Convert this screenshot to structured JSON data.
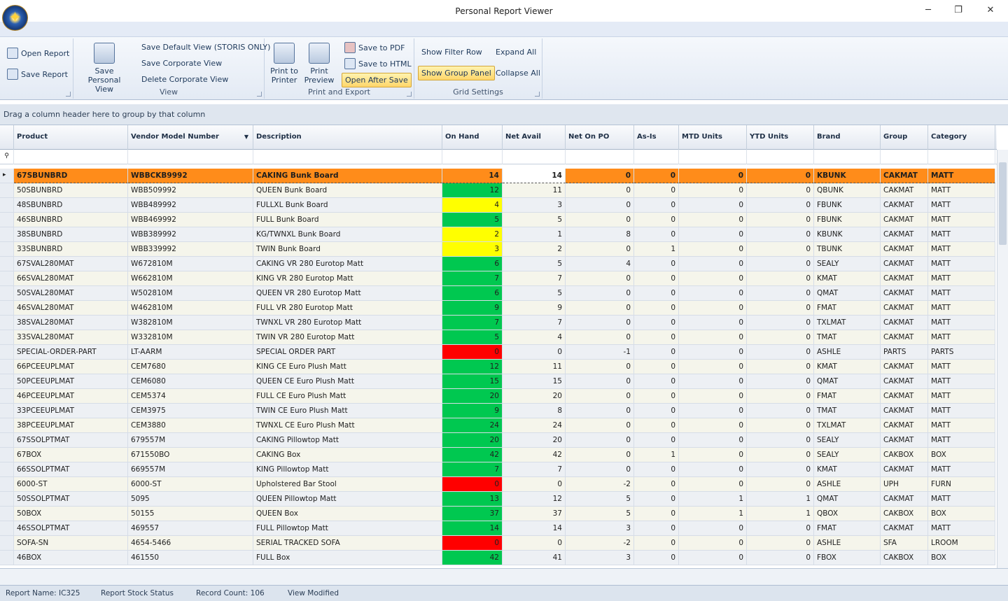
{
  "title": "Personal Report Viewer",
  "window": {
    "minimize": "─",
    "maximize": "❐",
    "close": "✕"
  },
  "ribbon": {
    "open_report": "Open Report",
    "save_report": "Save Report",
    "save_personal_view": "Save Personal View",
    "save_default_view": "Save Default View (STORIS ONLY)",
    "save_corporate_view": "Save Corporate View",
    "delete_corporate_view": "Delete Corporate View",
    "view_group": "View",
    "print_to_printer": "Print to Printer",
    "print_preview": "Print Preview",
    "save_to_pdf": "Save to PDF",
    "save_to_html": "Save to HTML",
    "open_after_save": "Open After Save",
    "print_export_group": "Print and Export",
    "show_filter_row": "Show Filter Row",
    "show_group_panel": "Show Group Panel",
    "expand_all": "Expand All",
    "collapse_all": "Collapse All",
    "grid_settings_group": "Grid Settings"
  },
  "group_panel_text": "Drag a column header here to group by that column",
  "columns": [
    "Product",
    "Vendor Model Number",
    "Description",
    "On Hand",
    "Net Avail",
    "Net On PO",
    "As-Is",
    "MTD Units",
    "YTD Units",
    "Brand",
    "Group",
    "Category"
  ],
  "colors": {
    "green": "#00c850",
    "yellow": "#ffff00",
    "red": "#ff0000",
    "selected": "#ff8c1a"
  },
  "rows": [
    [
      "67SBUNBRD",
      "WBBCKB9992",
      "CAKING Bunk Board",
      "14",
      "14",
      "0",
      "0",
      "0",
      "0",
      "KBUNK",
      "CAKMAT",
      "MATT",
      "sel"
    ],
    [
      "50SBUNBRD",
      "WBB509992",
      "QUEEN Bunk Board",
      "12",
      "11",
      "0",
      "0",
      "0",
      "0",
      "QBUNK",
      "CAKMAT",
      "MATT",
      "green"
    ],
    [
      "48SBUNBRD",
      "WBB489992",
      "FULLXL Bunk Board",
      "4",
      "3",
      "0",
      "0",
      "0",
      "0",
      "FBUNK",
      "CAKMAT",
      "MATT",
      "yellow"
    ],
    [
      "46SBUNBRD",
      "WBB469992",
      "FULL Bunk Board",
      "5",
      "5",
      "0",
      "0",
      "0",
      "0",
      "FBUNK",
      "CAKMAT",
      "MATT",
      "green"
    ],
    [
      "38SBUNBRD",
      "WBB389992",
      "KG/TWNXL Bunk Board",
      "2",
      "1",
      "8",
      "0",
      "0",
      "0",
      "KBUNK",
      "CAKMAT",
      "MATT",
      "yellow"
    ],
    [
      "33SBUNBRD",
      "WBB339992",
      "TWIN Bunk Board",
      "3",
      "2",
      "0",
      "1",
      "0",
      "0",
      "TBUNK",
      "CAKMAT",
      "MATT",
      "yellow"
    ],
    [
      "67SVAL280MAT",
      "W672810M",
      "CAKING VR 280 Eurotop Matt",
      "6",
      "5",
      "4",
      "0",
      "0",
      "0",
      "SEALY",
      "CAKMAT",
      "MATT",
      "green"
    ],
    [
      "66SVAL280MAT",
      "W662810M",
      "KING VR 280 Eurotop Matt",
      "7",
      "7",
      "0",
      "0",
      "0",
      "0",
      "KMAT",
      "CAKMAT",
      "MATT",
      "green"
    ],
    [
      "50SVAL280MAT",
      "W502810M",
      "QUEEN VR 280 Eurotop Matt",
      "6",
      "5",
      "0",
      "0",
      "0",
      "0",
      "QMAT",
      "CAKMAT",
      "MATT",
      "green"
    ],
    [
      "46SVAL280MAT",
      "W462810M",
      "FULL VR 280 Eurotop Matt",
      "9",
      "9",
      "0",
      "0",
      "0",
      "0",
      "FMAT",
      "CAKMAT",
      "MATT",
      "green"
    ],
    [
      "38SVAL280MAT",
      "W382810M",
      "TWNXL VR 280 Eurotop Matt",
      "7",
      "7",
      "0",
      "0",
      "0",
      "0",
      "TXLMAT",
      "CAKMAT",
      "MATT",
      "green"
    ],
    [
      "33SVAL280MAT",
      "W332810M",
      "TWIN VR 280 Eurotop Matt",
      "5",
      "4",
      "0",
      "0",
      "0",
      "0",
      "TMAT",
      "CAKMAT",
      "MATT",
      "green"
    ],
    [
      "SPECIAL-ORDER-PART",
      "LT-AARM",
      "SPECIAL ORDER PART",
      "0",
      "0",
      "-1",
      "0",
      "0",
      "0",
      "ASHLE",
      "PARTS",
      "PARTS",
      "red"
    ],
    [
      "66PCEEUPLMAT",
      "CEM7680",
      "KING CE Euro Plush Matt",
      "12",
      "11",
      "0",
      "0",
      "0",
      "0",
      "KMAT",
      "CAKMAT",
      "MATT",
      "green"
    ],
    [
      "50PCEEUPLMAT",
      "CEM6080",
      "QUEEN CE Euro Plush Matt",
      "15",
      "15",
      "0",
      "0",
      "0",
      "0",
      "QMAT",
      "CAKMAT",
      "MATT",
      "green"
    ],
    [
      "46PCEEUPLMAT",
      "CEM5374",
      "FULL CE Euro Plush Matt",
      "20",
      "20",
      "0",
      "0",
      "0",
      "0",
      "FMAT",
      "CAKMAT",
      "MATT",
      "green"
    ],
    [
      "33PCEEUPLMAT",
      "CEM3975",
      "TWIN CE Euro Plush Matt",
      "9",
      "8",
      "0",
      "0",
      "0",
      "0",
      "TMAT",
      "CAKMAT",
      "MATT",
      "green"
    ],
    [
      "38PCEEUPLMAT",
      "CEM3880",
      "TWNXL CE Euro Plush Matt",
      "24",
      "24",
      "0",
      "0",
      "0",
      "0",
      "TXLMAT",
      "CAKMAT",
      "MATT",
      "green"
    ],
    [
      "67SSOLPTMAT",
      "679557M",
      "CAKING Pillowtop Matt",
      "20",
      "20",
      "0",
      "0",
      "0",
      "0",
      "SEALY",
      "CAKMAT",
      "MATT",
      "green"
    ],
    [
      "67BOX",
      "671550BO",
      "CAKING Box",
      "42",
      "42",
      "0",
      "1",
      "0",
      "0",
      "SEALY",
      "CAKBOX",
      "BOX",
      "green"
    ],
    [
      "66SSOLPTMAT",
      "669557M",
      "KING Pillowtop Matt",
      "7",
      "7",
      "0",
      "0",
      "0",
      "0",
      "KMAT",
      "CAKMAT",
      "MATT",
      "green"
    ],
    [
      "6000-ST",
      "6000-ST",
      "Upholstered Bar Stool",
      "0",
      "0",
      "-2",
      "0",
      "0",
      "0",
      "ASHLE",
      "UPH",
      "FURN",
      "red"
    ],
    [
      "50SSOLPTMAT",
      "5095",
      "QUEEN Pillowtop Matt",
      "13",
      "12",
      "5",
      "0",
      "1",
      "1",
      "QMAT",
      "CAKMAT",
      "MATT",
      "green"
    ],
    [
      "50BOX",
      "50155",
      "QUEEN Box",
      "37",
      "37",
      "5",
      "0",
      "1",
      "1",
      "QBOX",
      "CAKBOX",
      "BOX",
      "green"
    ],
    [
      "46SSOLPTMAT",
      "469557",
      "FULL Pillowtop Matt",
      "14",
      "14",
      "3",
      "0",
      "0",
      "0",
      "FMAT",
      "CAKMAT",
      "MATT",
      "green"
    ],
    [
      "SOFA-SN",
      "4654-5466",
      "SERIAL TRACKED SOFA",
      "0",
      "0",
      "-2",
      "0",
      "0",
      "0",
      "ASHLE",
      "SFA",
      "LROOM",
      "red"
    ],
    [
      "46BOX",
      "461550",
      "FULL Box",
      "42",
      "41",
      "3",
      "0",
      "0",
      "0",
      "FBOX",
      "CAKBOX",
      "BOX",
      "green"
    ]
  ],
  "status": {
    "report_name": "Report Name: IC325",
    "report_title": "Report Stock Status",
    "record_count": "Record Count: 106",
    "view_state": "View Modified"
  }
}
